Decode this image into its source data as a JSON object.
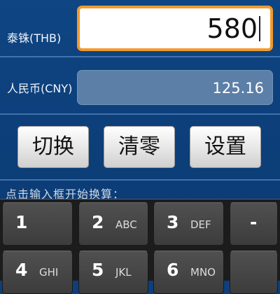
{
  "converter": {
    "source_label": "泰铢(THB)",
    "source_value": "580",
    "target_label": "人民币(CNY)",
    "target_value": "125.16"
  },
  "buttons": {
    "switch_label": "切换",
    "clear_label": "清零",
    "settings_label": "设置"
  },
  "hint": "点击输入框开始换算：",
  "keyboard": {
    "keys": [
      {
        "num": "1",
        "letters": ""
      },
      {
        "num": "2",
        "letters": "ABC"
      },
      {
        "num": "3",
        "letters": "DEF"
      },
      {
        "num": "-",
        "letters": ""
      },
      {
        "num": "4",
        "letters": "GHI"
      },
      {
        "num": "5",
        "letters": "JKL"
      },
      {
        "num": "6",
        "letters": "MNO"
      },
      {
        "num": "",
        "letters": ""
      }
    ]
  },
  "colors": {
    "background": "#0e3f7c",
    "active_border": "#f29a2e",
    "readonly_field": "#5c7fa8",
    "keyboard_bg": "#1c1c1c"
  }
}
